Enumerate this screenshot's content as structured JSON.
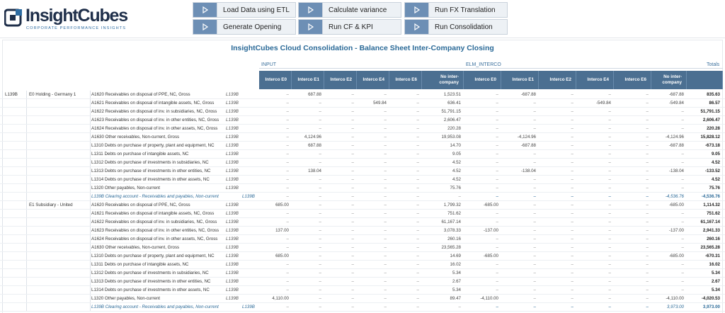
{
  "app": {
    "logo_name": "InsightCubes",
    "logo_tagline": "CORPORATE PERFORMANCE INSIGHTS"
  },
  "toolbar": {
    "buttons": [
      {
        "label": "Load Data using ETL",
        "icon": "play-icon"
      },
      {
        "label": "Calculate variance",
        "icon": "play-icon"
      },
      {
        "label": "Run FX Translation",
        "icon": "play-icon"
      },
      {
        "label": "Generate Opening",
        "icon": "play-icon"
      },
      {
        "label": "Run CF & KPI",
        "icon": "play-icon"
      },
      {
        "label": "Run Consolidation",
        "icon": "play-icon"
      }
    ]
  },
  "report": {
    "title": "InsightCubes Cloud Consolidation - Balance Sheet Inter-Company Closing",
    "group_headers": {
      "input": "INPUT",
      "elim": "ELM_INTERCO",
      "totals": "Totals"
    },
    "columns": [
      "Interco E0",
      "Interco E1",
      "Interco E2",
      "Interco E4",
      "Interco E6",
      "No inter-company",
      "Interco E0",
      "Interco E1",
      "Interco E2",
      "Interco E4",
      "Interco E6",
      "No inter-company"
    ],
    "entity_code": "L139B",
    "entities": [
      "E0 Holding - Germany 1",
      "E1 Subsidiary - United"
    ],
    "sections": [
      {
        "rows": [
          {
            "label": "A1620 Receivables on disposal of PPE, NC, Gross",
            "code": "L139B",
            "values": [
              "–",
              "687.88",
              "–",
              "–",
              "–",
              "1,523.51",
              "–",
              "-687.88",
              "–",
              "–",
              "–",
              "-687.88"
            ],
            "total": "835.63"
          },
          {
            "label": "A1621 Receivables on disposal of intangible assets, NC, Gross",
            "code": "L139B",
            "values": [
              "–",
              "–",
              "–",
              "549.84",
              "–",
              "636.41",
              "–",
              "–",
              "–",
              "-549.84",
              "–",
              "-549.84"
            ],
            "total": "86.57"
          },
          {
            "label": "A1622 Receivables on disposal of inv. in subsidiaries, NC, Gross",
            "code": "L139B",
            "values": [
              "–",
              "–",
              "–",
              "–",
              "–",
              "51,791.15",
              "–",
              "–",
              "–",
              "–",
              "–",
              "–"
            ],
            "total": "51,791.15"
          },
          {
            "label": "A1623 Receivables on disposal of inv. in other entities, NC, Gross",
            "code": "L139B",
            "values": [
              "–",
              "–",
              "–",
              "–",
              "–",
              "2,606.47",
              "–",
              "–",
              "–",
              "–",
              "–",
              "–"
            ],
            "total": "2,606.47"
          },
          {
            "label": "A1624 Receivables on disposal of inv. in other assets, NC, Gross",
            "code": "L139B",
            "values": [
              "–",
              "–",
              "–",
              "–",
              "–",
              "220.28",
              "–",
              "–",
              "–",
              "–",
              "–",
              "–"
            ],
            "total": "220.28"
          },
          {
            "label": "A1630 Other receivables, Non-current, Gross",
            "code": "L139B",
            "values": [
              "–",
              "4,124.96",
              "–",
              "–",
              "–",
              "19,953.08",
              "–",
              "-4,124.96",
              "–",
              "–",
              "–",
              "-4,124.96"
            ],
            "total": "15,828.12"
          },
          {
            "label": "L1310 Debts on purchase of property, plant and equipment, NC",
            "code": "L139B",
            "values": [
              "–",
              "687.88",
              "–",
              "–",
              "–",
              "14.70",
              "–",
              "-687.88",
              "–",
              "–",
              "–",
              "-687.88"
            ],
            "total": "-673.18"
          },
          {
            "label": "L1311 Debts on purchase of intangible assets, NC",
            "code": "L139B",
            "values": [
              "–",
              "–",
              "–",
              "–",
              "–",
              "9.05",
              "–",
              "–",
              "–",
              "–",
              "–",
              "–"
            ],
            "total": "9.05"
          },
          {
            "label": "L1312 Debts on purchase of investments in subsidiaries, NC",
            "code": "L139B",
            "values": [
              "–",
              "–",
              "–",
              "–",
              "–",
              "4.52",
              "–",
              "–",
              "–",
              "–",
              "–",
              "–"
            ],
            "total": "4.52"
          },
          {
            "label": "L1313 Debts on purchase of investments in other entities, NC",
            "code": "L139B",
            "values": [
              "–",
              "138.04",
              "–",
              "–",
              "–",
              "4.52",
              "–",
              "-138.04",
              "–",
              "–",
              "–",
              "-138.04"
            ],
            "total": "-133.52"
          },
          {
            "label": "L1314 Debts on purchase of investments in other assets, NC",
            "code": "L139B",
            "values": [
              "–",
              "–",
              "–",
              "–",
              "–",
              "4.52",
              "–",
              "–",
              "–",
              "–",
              "–",
              "–"
            ],
            "total": "4.52"
          },
          {
            "label": "L1320 Other payables, Non-current",
            "code": "L139B",
            "values": [
              "–",
              "–",
              "–",
              "–",
              "–",
              "75.76",
              "–",
              "–",
              "–",
              "–",
              "–",
              "–"
            ],
            "total": "75.76"
          },
          {
            "label": "L139B Clearing account - Receivables and payables, Non-current",
            "code": "L139B",
            "clearing": true,
            "values": [
              "–",
              "–",
              "–",
              "–",
              "–",
              "–",
              "–",
              "–",
              "–",
              "–",
              "–",
              "-4,536.76"
            ],
            "total": "-4,536.76"
          }
        ]
      },
      {
        "rows": [
          {
            "label": "A1620 Receivables on disposal of PPE, NC, Gross",
            "code": "L139B",
            "values": [
              "685.00",
              "–",
              "–",
              "–",
              "–",
              "1,799.32",
              "-685.00",
              "–",
              "–",
              "–",
              "–",
              "-685.00"
            ],
            "total": "1,114.32"
          },
          {
            "label": "A1621 Receivables on disposal of intangible assets, NC, Gross",
            "code": "L139B",
            "values": [
              "–",
              "–",
              "–",
              "–",
              "–",
              "751.62",
              "–",
              "–",
              "–",
              "–",
              "–",
              "–"
            ],
            "total": "751.62"
          },
          {
            "label": "A1622 Receivables on disposal of inv. in subsidiaries, NC, Gross",
            "code": "L139B",
            "values": [
              "–",
              "–",
              "–",
              "–",
              "–",
              "61,167.14",
              "–",
              "–",
              "–",
              "–",
              "–",
              "–"
            ],
            "total": "61,167.14"
          },
          {
            "label": "A1623 Receivables on disposal of inv. in other entities, NC, Gross",
            "code": "L139B",
            "values": [
              "137.00",
              "–",
              "–",
              "–",
              "–",
              "3,078.33",
              "-137.00",
              "–",
              "–",
              "–",
              "–",
              "-137.00"
            ],
            "total": "2,941.33"
          },
          {
            "label": "A1624 Receivables on disposal of inv. in other assets, NC, Gross",
            "code": "L139B",
            "values": [
              "–",
              "–",
              "–",
              "–",
              "–",
              "260.16",
              "–",
              "–",
              "–",
              "–",
              "–",
              "–"
            ],
            "total": "260.16"
          },
          {
            "label": "A1630 Other receivables, Non-current, Gross",
            "code": "L139B",
            "values": [
              "–",
              "–",
              "–",
              "–",
              "–",
              "23,565.28",
              "–",
              "–",
              "–",
              "–",
              "–",
              "–"
            ],
            "total": "23,565.28"
          },
          {
            "label": "L1310 Debts on purchase of property, plant and equipment, NC",
            "code": "L139B",
            "values": [
              "685.00",
              "–",
              "–",
              "–",
              "–",
              "14.69",
              "-685.00",
              "–",
              "–",
              "–",
              "–",
              "-685.00"
            ],
            "total": "-670.31"
          },
          {
            "label": "L1311 Debts on purchase of intangible assets, NC",
            "code": "L139B",
            "values": [
              "–",
              "–",
              "–",
              "–",
              "–",
              "16.02",
              "–",
              "–",
              "–",
              "–",
              "–",
              "–"
            ],
            "total": "16.02"
          },
          {
            "label": "L1312 Debts on purchase of investments in subsidiaries, NC",
            "code": "L139B",
            "values": [
              "–",
              "–",
              "–",
              "–",
              "–",
              "5.34",
              "–",
              "–",
              "–",
              "–",
              "–",
              "–"
            ],
            "total": "5.34"
          },
          {
            "label": "L1313 Debts on purchase of investments in other entities, NC",
            "code": "L139B",
            "values": [
              "–",
              "–",
              "–",
              "–",
              "–",
              "2.67",
              "–",
              "–",
              "–",
              "–",
              "–",
              "–"
            ],
            "total": "2.67"
          },
          {
            "label": "L1314 Debts on purchase of investments in other assets, NC",
            "code": "L139B",
            "values": [
              "–",
              "–",
              "–",
              "–",
              "–",
              "5.34",
              "–",
              "–",
              "–",
              "–",
              "–",
              "–"
            ],
            "total": "5.34"
          },
          {
            "label": "L1320 Other payables, Non-current",
            "code": "L139B",
            "values": [
              "4,110.00",
              "–",
              "–",
              "–",
              "–",
              "89.47",
              "-4,110.00",
              "–",
              "–",
              "–",
              "–",
              "-4,110.00"
            ],
            "total": "-4,020.53"
          },
          {
            "label": "L139B Clearing account - Receivables and payables, Non-current",
            "code": "L139B",
            "clearing": true,
            "values": [
              "–",
              "–",
              "–",
              "–",
              "–",
              "–",
              "–",
              "–",
              "–",
              "–",
              "–",
              "3,973.00"
            ],
            "total": "3,973.00"
          }
        ]
      }
    ]
  },
  "colors": {
    "header_bg": "#4b6f91",
    "title": "#2b6a98",
    "button_icon": "#6d8fb5"
  }
}
